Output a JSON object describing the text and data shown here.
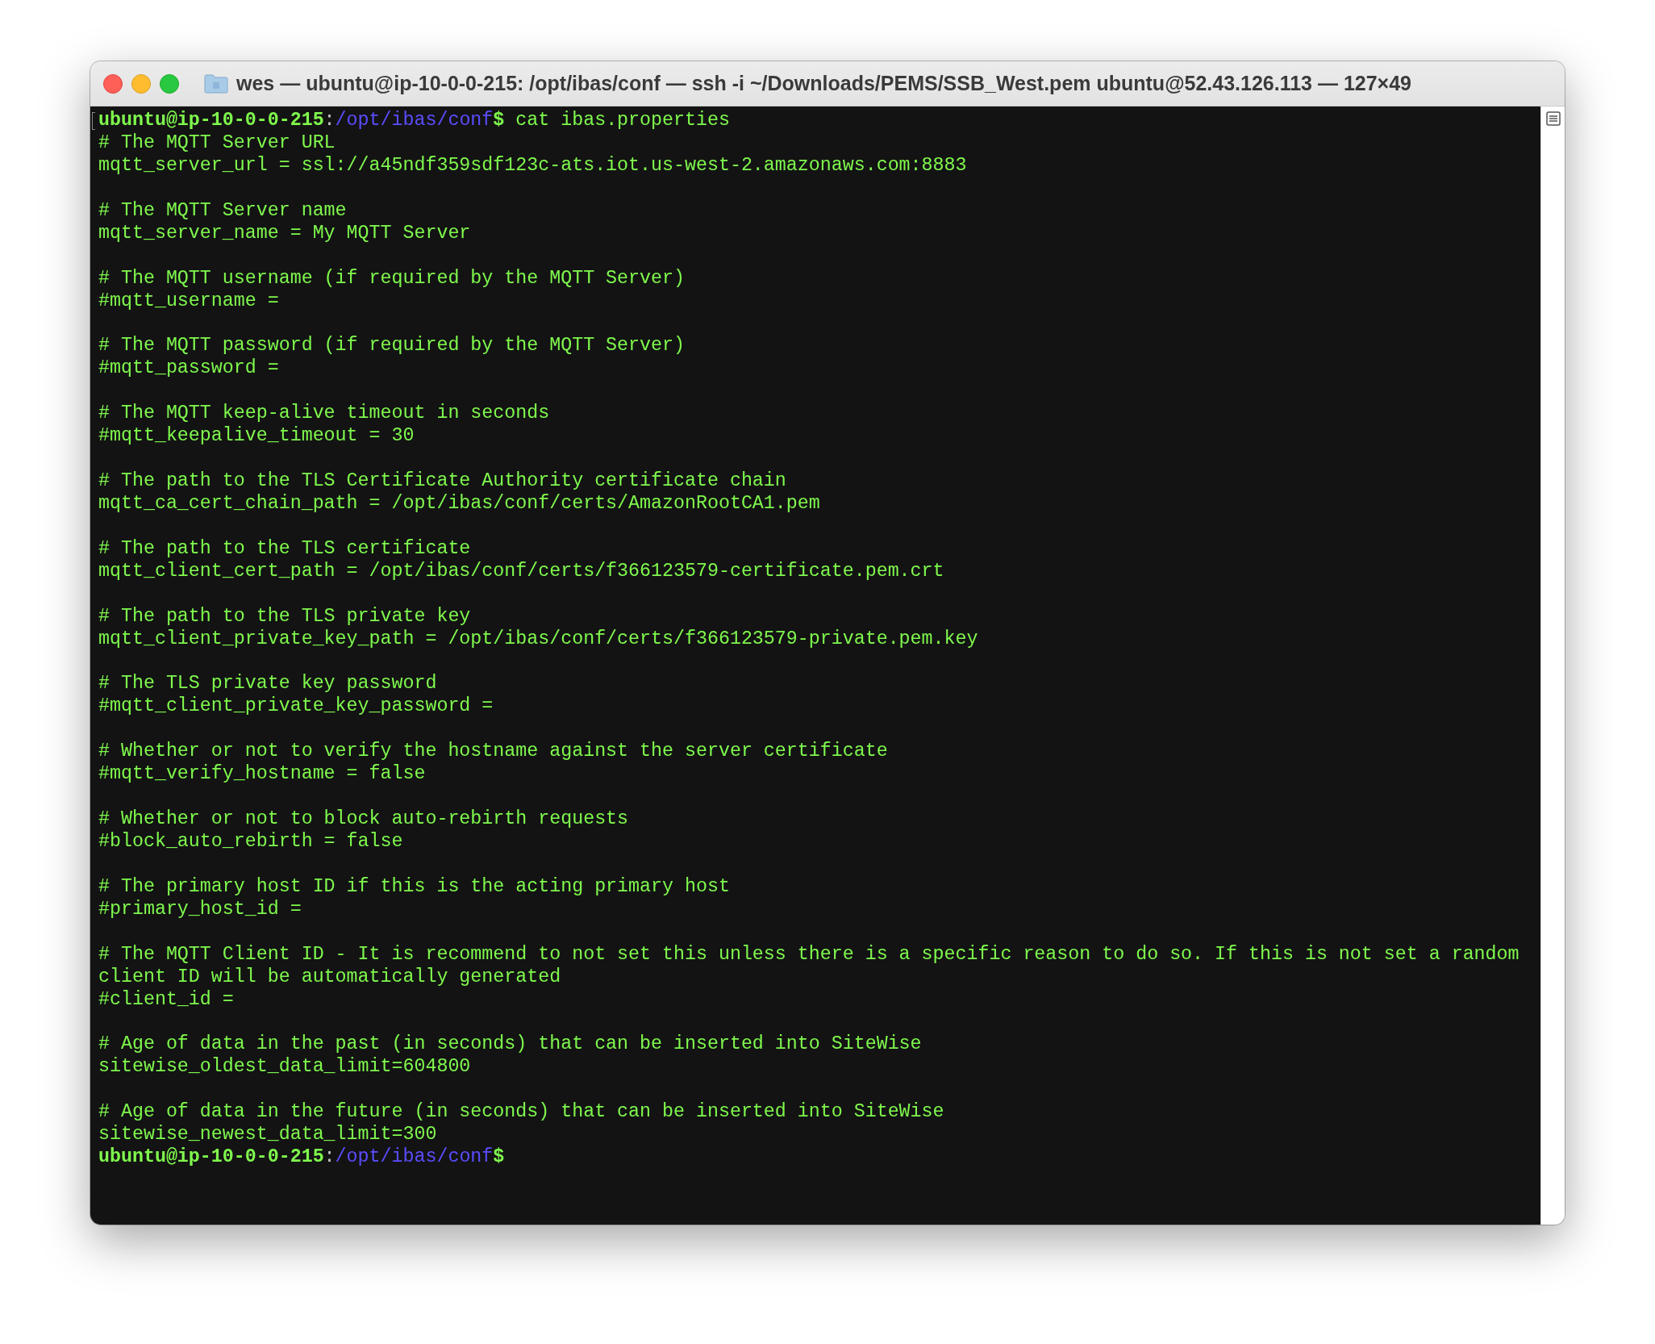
{
  "window": {
    "title": "wes — ubuntu@ip-10-0-0-215: /opt/ibas/conf — ssh -i ~/Downloads/PEMS/SSB_West.pem ubuntu@52.43.126.113 — 127×49"
  },
  "terminal": {
    "lines": [
      {
        "kind": "prompt",
        "marked": true,
        "user_host": "ubuntu@ip-10-0-0-215",
        "separator": ":",
        "path": "/opt/ibas/conf",
        "symbol": "$",
        "command": " cat ibas.properties"
      },
      {
        "kind": "comment",
        "text": "# The MQTT Server URL"
      },
      {
        "kind": "setting",
        "text": "mqtt_server_url = ssl://a45ndf359sdf123c-ats.iot.us-west-2.amazonaws.com:8883"
      },
      {
        "kind": "blank"
      },
      {
        "kind": "comment",
        "text": "# The MQTT Server name"
      },
      {
        "kind": "setting",
        "text": "mqtt_server_name = My MQTT Server"
      },
      {
        "kind": "blank"
      },
      {
        "kind": "comment",
        "text": "# The MQTT username (if required by the MQTT Server)"
      },
      {
        "kind": "setting",
        "text": "#mqtt_username ="
      },
      {
        "kind": "blank"
      },
      {
        "kind": "comment",
        "text": "# The MQTT password (if required by the MQTT Server)"
      },
      {
        "kind": "setting",
        "text": "#mqtt_password ="
      },
      {
        "kind": "blank"
      },
      {
        "kind": "comment",
        "text": "# The MQTT keep-alive timeout in seconds"
      },
      {
        "kind": "setting",
        "text": "#mqtt_keepalive_timeout = 30"
      },
      {
        "kind": "blank"
      },
      {
        "kind": "comment",
        "text": "# The path to the TLS Certificate Authority certificate chain"
      },
      {
        "kind": "setting",
        "text": "mqtt_ca_cert_chain_path = /opt/ibas/conf/certs/AmazonRootCA1.pem"
      },
      {
        "kind": "blank"
      },
      {
        "kind": "comment",
        "text": "# The path to the TLS certificate"
      },
      {
        "kind": "setting",
        "text": "mqtt_client_cert_path = /opt/ibas/conf/certs/f366123579-certificate.pem.crt"
      },
      {
        "kind": "blank"
      },
      {
        "kind": "comment",
        "text": "# The path to the TLS private key"
      },
      {
        "kind": "setting",
        "text": "mqtt_client_private_key_path = /opt/ibas/conf/certs/f366123579-private.pem.key"
      },
      {
        "kind": "blank"
      },
      {
        "kind": "comment",
        "text": "# The TLS private key password"
      },
      {
        "kind": "setting",
        "text": "#mqtt_client_private_key_password ="
      },
      {
        "kind": "blank"
      },
      {
        "kind": "comment",
        "text": "# Whether or not to verify the hostname against the server certificate"
      },
      {
        "kind": "setting",
        "text": "#mqtt_verify_hostname = false"
      },
      {
        "kind": "blank"
      },
      {
        "kind": "comment",
        "text": "# Whether or not to block auto-rebirth requests"
      },
      {
        "kind": "setting",
        "text": "#block_auto_rebirth = false"
      },
      {
        "kind": "blank"
      },
      {
        "kind": "comment",
        "text": "# The primary host ID if this is the acting primary host"
      },
      {
        "kind": "setting",
        "text": "#primary_host_id ="
      },
      {
        "kind": "blank"
      },
      {
        "kind": "comment",
        "text": "# The MQTT Client ID - It is recommend to not set this unless there is a specific reason to do so. If this is not set a random"
      },
      {
        "kind": "comment",
        "text": "client ID will be automatically generated"
      },
      {
        "kind": "setting",
        "text": "#client_id ="
      },
      {
        "kind": "blank"
      },
      {
        "kind": "comment",
        "text": "# Age of data in the past (in seconds) that can be inserted into SiteWise"
      },
      {
        "kind": "setting",
        "text": "sitewise_oldest_data_limit=604800"
      },
      {
        "kind": "blank"
      },
      {
        "kind": "comment",
        "text": "# Age of data in the future (in seconds) that can be inserted into SiteWise"
      },
      {
        "kind": "setting",
        "text": "sitewise_newest_data_limit=300"
      },
      {
        "kind": "prompt",
        "marked": false,
        "user_host": "ubuntu@ip-10-0-0-215",
        "separator": ":",
        "path": "/opt/ibas/conf",
        "symbol": "$"
      }
    ]
  }
}
